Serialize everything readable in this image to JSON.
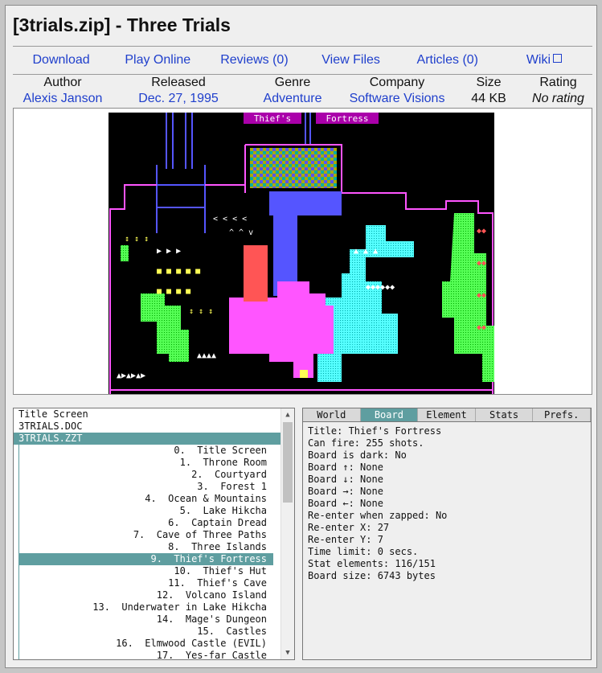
{
  "page": {
    "title": "[3trials.zip] - Three Trials"
  },
  "nav": {
    "download": "Download",
    "play_online": "Play Online",
    "reviews": "Reviews (0)",
    "view_files": "View Files",
    "articles": "Articles (0)",
    "wiki": "Wiki"
  },
  "meta": {
    "author_label": "Author",
    "author": "Alexis Janson",
    "released_label": "Released",
    "released": "Dec. 27, 1995",
    "genre_label": "Genre",
    "genre": "Adventure",
    "company_label": "Company",
    "company": "Software Visions",
    "size_label": "Size",
    "size": "44 KB",
    "rating_label": "Rating",
    "rating": "No rating"
  },
  "board_title": "Thief's Fortress",
  "files": [
    "Title Screen",
    "3TRIALS.DOC",
    "3TRIALS.ZZT"
  ],
  "boards": [
    "0.  Title Screen",
    "1.  Throne Room",
    "2.  Courtyard",
    "3.  Forest 1",
    "4.  Ocean & Mountains",
    "5.  Lake Hikcha",
    "6.  Captain Dread",
    "7.  Cave of Three Paths",
    "8.  Three Islands",
    "9.  Thief's Fortress",
    "10.  Thief's Hut",
    "11.  Thief's Cave",
    "12.  Volcano Island",
    "13.  Underwater in Lake Hikcha",
    "14.  Mage's Dungeon",
    "15.  Castles",
    "16.  Elmwood Castle (EVIL)",
    "17.  Yes-far Castle"
  ],
  "tabs": [
    "World",
    "Board",
    "Element",
    "Stats",
    "Prefs."
  ],
  "info": [
    "Title: Thief's Fortress",
    "Can fire: 255 shots.",
    "Board is dark: No",
    "Board ↑: None",
    "Board ↓: None",
    "Board →: None",
    "Board ←: None",
    "Re-enter when zapped: No",
    "Re-enter X: 27",
    "Re-enter Y: 7",
    "Time limit: 0 secs.",
    "Stat elements: 116/151",
    "Board size: 6743 bytes"
  ],
  "colors": {
    "accent": "#5f9ea0",
    "link": "#1f3fcc"
  }
}
